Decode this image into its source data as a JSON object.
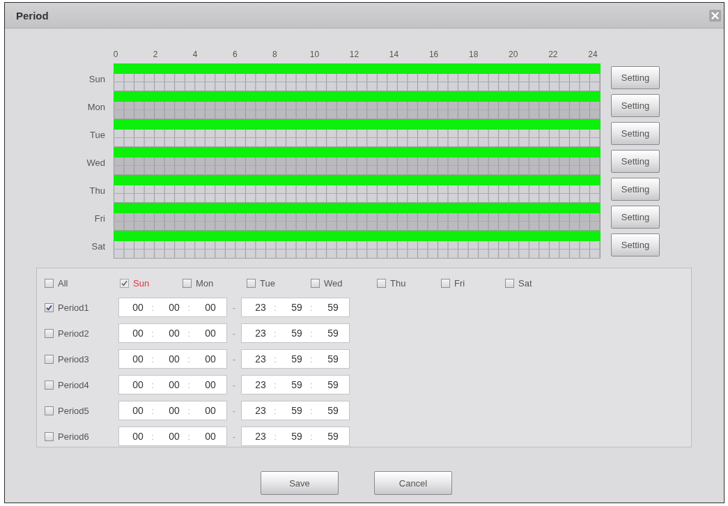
{
  "window": {
    "title": "Period"
  },
  "timeline": {
    "hour_labels": [
      "0",
      "2",
      "4",
      "6",
      "8",
      "10",
      "12",
      "14",
      "16",
      "18",
      "20",
      "22",
      "24"
    ]
  },
  "days": [
    {
      "label": "Sun",
      "level": 1,
      "button": "Setting"
    },
    {
      "label": "Mon",
      "level": 1,
      "button": "Setting"
    },
    {
      "label": "Tue",
      "level": 1,
      "button": "Setting"
    },
    {
      "label": "Wed",
      "level": 1,
      "button": "Setting"
    },
    {
      "label": "Thu",
      "level": 1,
      "button": "Setting"
    },
    {
      "label": "Fri",
      "level": 1,
      "button": "Setting"
    },
    {
      "label": "Sat",
      "level": 1,
      "button": "Setting"
    }
  ],
  "day_options": [
    {
      "label": "All",
      "checked": false,
      "disabled": false,
      "selected": false
    },
    {
      "label": "Sun",
      "checked": true,
      "disabled": true,
      "selected": true
    },
    {
      "label": "Mon",
      "checked": false,
      "disabled": false,
      "selected": false
    },
    {
      "label": "Tue",
      "checked": false,
      "disabled": false,
      "selected": false
    },
    {
      "label": "Wed",
      "checked": false,
      "disabled": false,
      "selected": false
    },
    {
      "label": "Thu",
      "checked": false,
      "disabled": false,
      "selected": false
    },
    {
      "label": "Fri",
      "checked": false,
      "disabled": false,
      "selected": false
    },
    {
      "label": "Sat",
      "checked": false,
      "disabled": false,
      "selected": false
    }
  ],
  "periods": [
    {
      "label": "Period1",
      "checked": true,
      "start": [
        "00",
        ":",
        "00",
        ":",
        "00"
      ],
      "dash": "-",
      "end": [
        "23",
        ":",
        "59",
        ":",
        "59"
      ]
    },
    {
      "label": "Period2",
      "checked": false,
      "start": [
        "00",
        ":",
        "00",
        ":",
        "00"
      ],
      "dash": "-",
      "end": [
        "23",
        ":",
        "59",
        ":",
        "59"
      ]
    },
    {
      "label": "Period3",
      "checked": false,
      "start": [
        "00",
        ":",
        "00",
        ":",
        "00"
      ],
      "dash": "-",
      "end": [
        "23",
        ":",
        "59",
        ":",
        "59"
      ]
    },
    {
      "label": "Period4",
      "checked": false,
      "start": [
        "00",
        ":",
        "00",
        ":",
        "00"
      ],
      "dash": "-",
      "end": [
        "23",
        ":",
        "59",
        ":",
        "59"
      ]
    },
    {
      "label": "Period5",
      "checked": false,
      "start": [
        "00",
        ":",
        "00",
        ":",
        "00"
      ],
      "dash": "-",
      "end": [
        "23",
        ":",
        "59",
        ":",
        "59"
      ]
    },
    {
      "label": "Period6",
      "checked": false,
      "start": [
        "00",
        ":",
        "00",
        ":",
        "00"
      ],
      "dash": "-",
      "end": [
        "23",
        ":",
        "59",
        ":",
        "59"
      ]
    }
  ],
  "buttons": [
    {
      "label": "Save"
    },
    {
      "label": "Cancel"
    }
  ]
}
